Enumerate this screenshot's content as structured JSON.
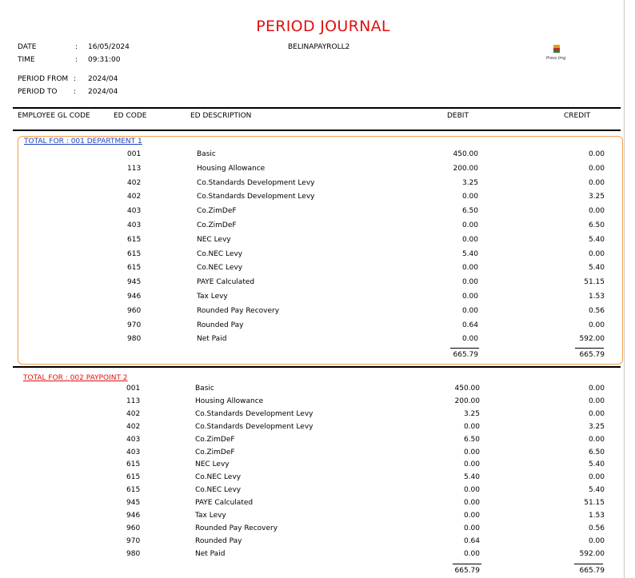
{
  "report": {
    "title": "PERIOD JOURNAL",
    "company": "BELINAPAYROLL2",
    "logo_caption": "Press Img",
    "meta": [
      {
        "label": "DATE",
        "value": "16/05/2024"
      },
      {
        "label": "TIME",
        "value": "09:31:00"
      },
      {
        "label": "PERIOD FROM",
        "value": "2024/04"
      },
      {
        "label": "PERIOD TO",
        "value": "2024/04"
      }
    ],
    "colon": ":"
  },
  "columns": {
    "gl_code": "EMPLOYEE GL CODE",
    "ed_code": "ED CODE",
    "ed_description": "ED DESCRIPTION",
    "debit": "DEBIT",
    "credit": "CREDIT"
  },
  "colors": {
    "title": "#e01010",
    "section1_link": "#1f3fbf",
    "section2_link": "#e01010",
    "section_border": "#f0a050"
  },
  "sections": [
    {
      "prefix": "TOTAL FOR :",
      "name": "001 DEPARTMENT 1",
      "rows": [
        {
          "code": "001",
          "desc": "Basic",
          "debit": "450.00",
          "credit": "0.00"
        },
        {
          "code": "113",
          "desc": "Housing Allowance",
          "debit": "200.00",
          "credit": "0.00"
        },
        {
          "code": "402",
          "desc": "Co.Standards Development Levy",
          "debit": "3.25",
          "credit": "0.00"
        },
        {
          "code": "402",
          "desc": "Co.Standards Development Levy",
          "debit": "0.00",
          "credit": "3.25"
        },
        {
          "code": "403",
          "desc": "Co.ZimDeF",
          "debit": "6.50",
          "credit": "0.00"
        },
        {
          "code": "403",
          "desc": "Co.ZimDeF",
          "debit": "0.00",
          "credit": "6.50"
        },
        {
          "code": "615",
          "desc": "NEC Levy",
          "debit": "0.00",
          "credit": "5.40"
        },
        {
          "code": "615",
          "desc": "Co.NEC Levy",
          "debit": "5.40",
          "credit": "0.00"
        },
        {
          "code": "615",
          "desc": "Co.NEC Levy",
          "debit": "0.00",
          "credit": "5.40"
        },
        {
          "code": "945",
          "desc": "PAYE Calculated",
          "debit": "0.00",
          "credit": "51.15"
        },
        {
          "code": "946",
          "desc": "Tax Levy",
          "debit": "0.00",
          "credit": "1.53"
        },
        {
          "code": "960",
          "desc": "Rounded Pay Recovery",
          "debit": "0.00",
          "credit": "0.56"
        },
        {
          "code": "970",
          "desc": "Rounded Pay",
          "debit": "0.64",
          "credit": "0.00"
        },
        {
          "code": "980",
          "desc": "Net Paid",
          "debit": "0.00",
          "credit": "592.00"
        }
      ],
      "total_debit": "665.79",
      "total_credit": "665.79"
    },
    {
      "prefix": "TOTAL FOR :",
      "name": "002 PAYPOINT 2",
      "rows": [
        {
          "code": "001",
          "desc": "Basic",
          "debit": "450.00",
          "credit": "0.00"
        },
        {
          "code": "113",
          "desc": "Housing Allowance",
          "debit": "200.00",
          "credit": "0.00"
        },
        {
          "code": "402",
          "desc": "Co.Standards Development Levy",
          "debit": "3.25",
          "credit": "0.00"
        },
        {
          "code": "402",
          "desc": "Co.Standards Development Levy",
          "debit": "0.00",
          "credit": "3.25"
        },
        {
          "code": "403",
          "desc": "Co.ZimDeF",
          "debit": "6.50",
          "credit": "0.00"
        },
        {
          "code": "403",
          "desc": "Co.ZimDeF",
          "debit": "0.00",
          "credit": "6.50"
        },
        {
          "code": "615",
          "desc": "NEC Levy",
          "debit": "0.00",
          "credit": "5.40"
        },
        {
          "code": "615",
          "desc": "Co.NEC Levy",
          "debit": "5.40",
          "credit": "0.00"
        },
        {
          "code": "615",
          "desc": "Co.NEC Levy",
          "debit": "0.00",
          "credit": "5.40"
        },
        {
          "code": "945",
          "desc": "PAYE Calculated",
          "debit": "0.00",
          "credit": "51.15"
        },
        {
          "code": "946",
          "desc": "Tax Levy",
          "debit": "0.00",
          "credit": "1.53"
        },
        {
          "code": "960",
          "desc": "Rounded Pay Recovery",
          "debit": "0.00",
          "credit": "0.56"
        },
        {
          "code": "970",
          "desc": "Rounded Pay",
          "debit": "0.64",
          "credit": "0.00"
        },
        {
          "code": "980",
          "desc": "Net Paid",
          "debit": "0.00",
          "credit": "592.00"
        }
      ],
      "total_debit": "665.79",
      "total_credit": "665.79"
    }
  ]
}
